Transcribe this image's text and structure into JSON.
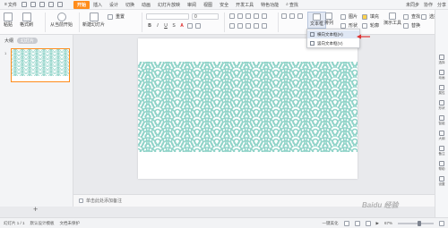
{
  "menubar": {
    "file_label": "文件",
    "tabs": [
      {
        "label": "开始",
        "active": true
      },
      {
        "label": "插入"
      },
      {
        "label": "设计"
      },
      {
        "label": "切换"
      },
      {
        "label": "动画"
      },
      {
        "label": "幻灯片放映"
      },
      {
        "label": "审阅"
      },
      {
        "label": "视图"
      },
      {
        "label": "安全"
      },
      {
        "label": "开发工具"
      },
      {
        "label": "特色功能"
      }
    ],
    "search_label": "查找",
    "right_items": [
      "未同步",
      "协作",
      "分享"
    ]
  },
  "ribbon": {
    "paste_label": "粘贴",
    "format_painter_label": "格式刷",
    "from_start_label": "从当前开始",
    "new_slide_label": "新建幻灯片",
    "reset_label": "重置",
    "textbox_label": "文本框",
    "arrange_label": "排列",
    "shape_label": "形状",
    "picture_label": "图片",
    "fill_label": "填充",
    "outline_label": "轮廓",
    "find_label": "查找",
    "replace_label": "替换",
    "select_label": "选择",
    "demo_tools_label": "演示工具",
    "font_size_value": "0"
  },
  "textbox_menu": {
    "items": [
      {
        "label": "横向文本框(H)"
      },
      {
        "label": "竖向文本框(V)"
      }
    ]
  },
  "left_panel": {
    "tabs": [
      "大纲",
      "幻灯片"
    ],
    "slide_number": "1",
    "add_slide": "+"
  },
  "notes": {
    "placeholder": "单击此处添加备注"
  },
  "right_panel": {
    "items": [
      "选择",
      "动画",
      "属性",
      "形状",
      "智能",
      "大纲",
      "备注",
      "帮助",
      "设置"
    ]
  },
  "statusbar": {
    "slide_info": "幻灯片 1 / 1",
    "theme": "默认设计模板",
    "doc_protect": "文档未保护",
    "notes_btn": "一键美化",
    "zoom": "67%"
  },
  "watermark": {
    "text": "Baidu 经验"
  },
  "colors": {
    "accent": "#ff8c1a",
    "wave": "#8fd3c8",
    "dropdown_hover": "#dfe7f4"
  }
}
